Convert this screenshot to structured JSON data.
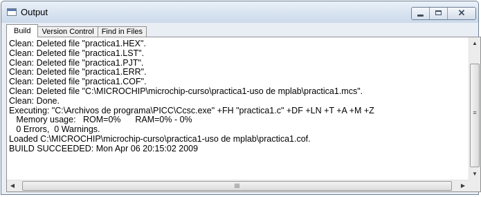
{
  "window": {
    "title": "Output",
    "caption_buttons": {
      "minimize_icon": "minimize-icon",
      "maximize_icon": "maximize-icon",
      "close_icon": "close-icon",
      "close_glyph": "✕"
    }
  },
  "tabs": [
    {
      "label": "Build",
      "active": true
    },
    {
      "label": "Version Control",
      "active": false
    },
    {
      "label": "Find in Files",
      "active": false
    }
  ],
  "log": {
    "lines": [
      "Clean: Deleted file \"practica1.HEX\".",
      "Clean: Deleted file \"practica1.LST\".",
      "Clean: Deleted file \"practica1.PJT\".",
      "Clean: Deleted file \"practica1.ERR\".",
      "Clean: Deleted file \"practica1.COF\".",
      "Clean: Deleted file \"C:\\MICROCHIP\\microchip-curso\\practica1-uso de mplab\\practica1.mcs\".",
      "Clean: Done.",
      "Executing: \"C:\\Archivos de programa\\PICC\\Ccsc.exe\" +FH \"practica1.c\" +DF +LN +T +A +M +Z",
      "   Memory usage:   ROM=0%      RAM=0% - 0%",
      "   0 Errors,  0 Warnings.",
      "Loaded C:\\MICROCHIP\\microchip-curso\\practica1-uso de mplab\\practica1.cof.",
      "BUILD SUCCEEDED: Mon Apr 06 20:15:02 2009"
    ]
  },
  "scrollbars": {
    "up_glyph": "▲",
    "down_glyph": "▼",
    "left_glyph": "◀",
    "right_glyph": "▶",
    "vertical_grip": "≡",
    "horizontal_grip": "III"
  },
  "colors": {
    "titlebar": "#dbe6f2",
    "window_border": "#6f7f93",
    "panel_bg": "#ffffff"
  }
}
